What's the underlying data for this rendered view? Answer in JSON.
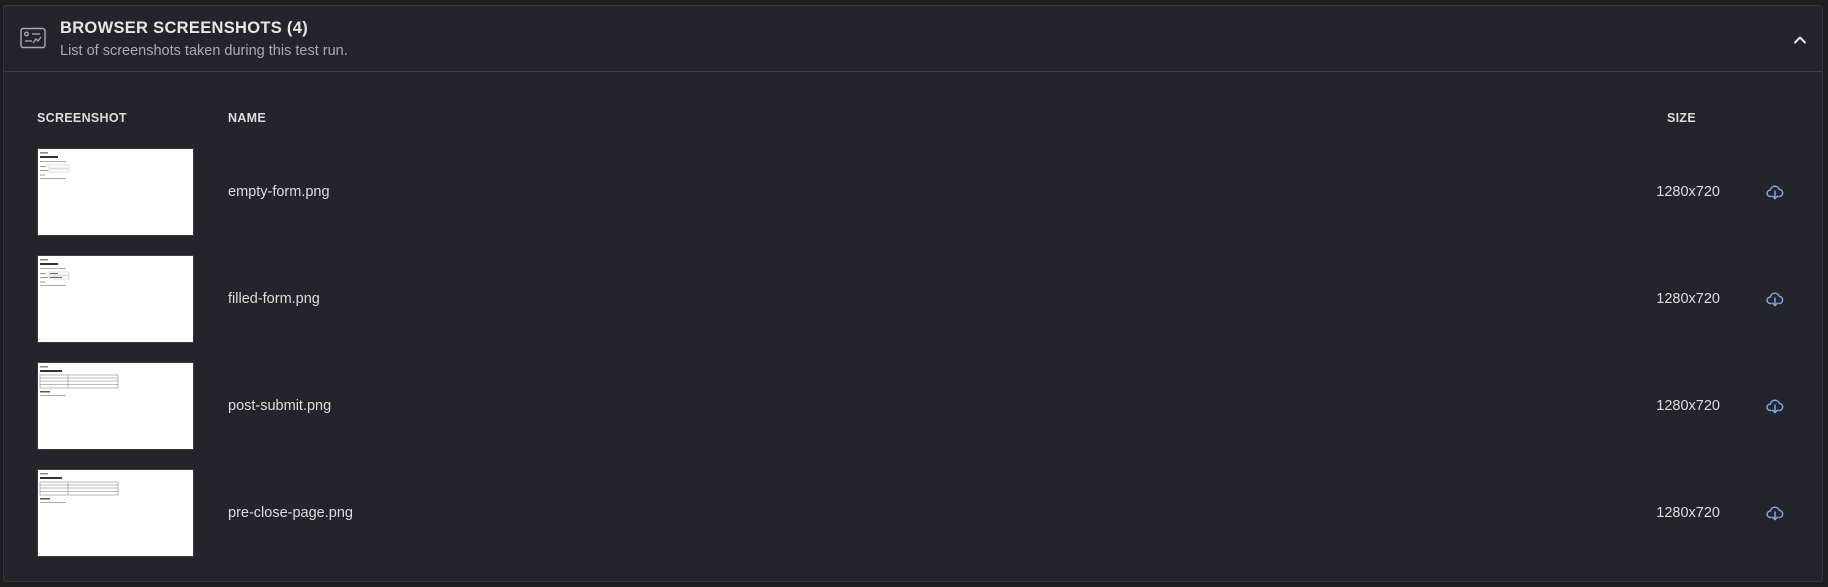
{
  "header": {
    "title": "BROWSER SCREENSHOTS (4)",
    "subtitle": "List of screenshots taken during this test run.",
    "icon": "screenshot-card-icon",
    "collapse_icon": "chevron-up-icon"
  },
  "table": {
    "columns": {
      "screenshot": "SCREENSHOT",
      "name": "NAME",
      "size": "SIZE"
    },
    "rows": [
      {
        "name": "empty-form.png",
        "size": "1280x720",
        "thumbnail": "form-page-thumbnail"
      },
      {
        "name": "filled-form.png",
        "size": "1280x720",
        "thumbnail": "form-page-thumbnail"
      },
      {
        "name": "post-submit.png",
        "size": "1280x720",
        "thumbnail": "table-page-thumbnail"
      },
      {
        "name": "pre-close-page.png",
        "size": "1280x720",
        "thumbnail": "table-page-thumbnail"
      }
    ]
  },
  "colors": {
    "background": "#1d1e22",
    "panel": "#24252b",
    "accent_icon": "#7fa6e0",
    "text": "#e6e7ea",
    "muted_text": "#a8abb3"
  }
}
